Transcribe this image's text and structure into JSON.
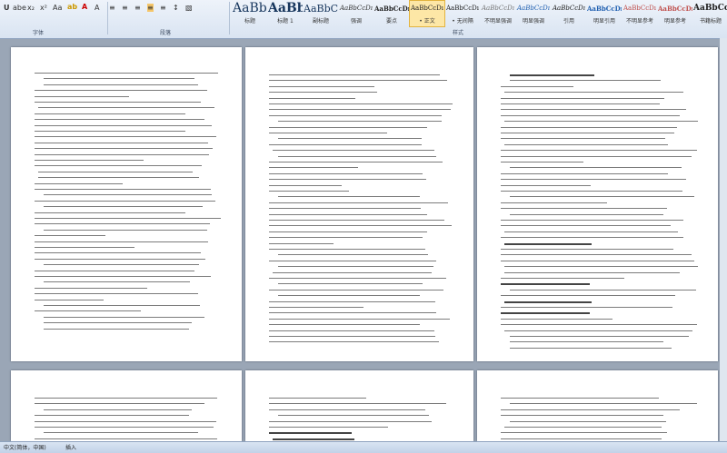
{
  "ribbon": {
    "group_font": "字体",
    "group_paragraph": "段落",
    "group_styles": "样式",
    "styles": [
      {
        "sample": "AaBbC",
        "name": "标题"
      },
      {
        "sample": "AaBb",
        "name": "标题 1"
      },
      {
        "sample": "AaBbC",
        "name": "副标题"
      },
      {
        "sample": "AaBbCcDı",
        "name": "强调"
      },
      {
        "sample": "AaBbCcDı",
        "name": "要点"
      },
      {
        "sample": "AaBbCcDı",
        "name": "• 正文"
      },
      {
        "sample": "AaBbCcDı",
        "name": "• 无间隔"
      },
      {
        "sample": "AaBbCcDı",
        "name": "不明显强调"
      },
      {
        "sample": "AaBbCcDı",
        "name": "明显强调"
      },
      {
        "sample": "AaBbCcDı",
        "name": "引用"
      },
      {
        "sample": "AaBbCcDı",
        "name": "明显引用"
      },
      {
        "sample": "AaBbCcDı",
        "name": "不明显参考"
      },
      {
        "sample": "AaBbCcDı",
        "name": "明显参考"
      },
      {
        "sample": "AaBbCcI",
        "name": "书籍标题"
      }
    ]
  },
  "status": {
    "language": "中文(简体，中国)",
    "mode": "插入"
  }
}
